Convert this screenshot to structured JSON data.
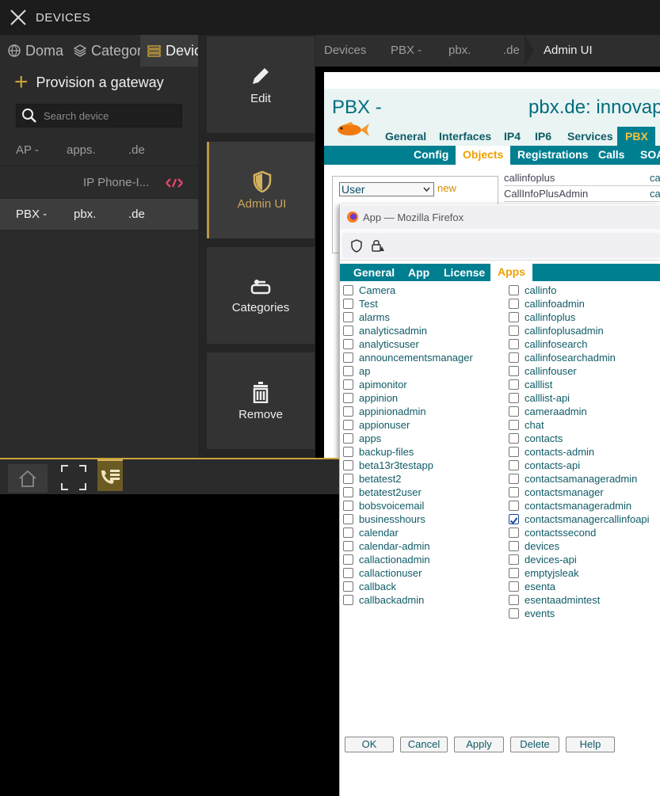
{
  "header": {
    "title": "DEVICES"
  },
  "tabs": [
    {
      "label": "Doma"
    },
    {
      "label": "Categor"
    },
    {
      "label": "Devic"
    }
  ],
  "provision": {
    "label": "Provision a gateway"
  },
  "search": {
    "placeholder": "Search device"
  },
  "devices": [
    {
      "col1": "AP -",
      "col2": "apps.",
      "col3": ".de"
    },
    {
      "col1": "",
      "col2": "IP Phone-I...",
      "col3": ""
    },
    {
      "col1": "PBX -",
      "col2": "pbx.",
      "col3": ".de"
    }
  ],
  "actions": [
    {
      "label": "Edit"
    },
    {
      "label": "Admin UI"
    },
    {
      "label": "Categories"
    },
    {
      "label": "Remove"
    }
  ],
  "breadcrumb": [
    "Devices",
    "PBX -",
    "pbx.",
    ".de",
    "Admin UI"
  ],
  "pbx": {
    "title": "PBX -",
    "domain": "pbx.de: innovap",
    "nav": [
      "General",
      "Interfaces",
      "IP4",
      "IP6",
      "Services",
      "PBX"
    ],
    "subnav": [
      "Config",
      "Objects",
      "Registrations",
      "Calls",
      "SOA"
    ],
    "objtype": "User",
    "new_label": "new",
    "objects": [
      {
        "name": "callinfoplus",
        "short": "ca"
      },
      {
        "name": "CallInfoPlusAdmin",
        "short": "ca"
      }
    ]
  },
  "popup": {
    "window_title": "App — Mozilla Firefox",
    "tabs": [
      "General",
      "App",
      "License",
      "Apps"
    ],
    "apps_left": [
      "Camera",
      "Test",
      "alarms",
      "analyticsadmin",
      "analyticsuser",
      "announcementsmanager",
      "ap",
      "apimonitor",
      "appinion",
      "appinionadmin",
      "appionuser",
      "apps",
      "backup-files",
      "beta13r3testapp",
      "betatest2",
      "betatest2user",
      "bobsvoicemail",
      "businesshours",
      "calendar",
      "calendar-admin",
      "callactionadmin",
      "callactionuser",
      "callback",
      "callbackadmin"
    ],
    "apps_right": [
      "callinfo",
      "callinfoadmin",
      "callinfoplus",
      "callinfoplusadmin",
      "callinfosearch",
      "callinfosearchadmin",
      "callinfouser",
      "calllist",
      "calllist-api",
      "cameraadmin",
      "chat",
      "contacts",
      "contacts-admin",
      "contacts-api",
      "contactsamanageradmin",
      "contactsmanager",
      "contactsmanageradmin",
      "contactsmanagercallinfoapi",
      "contactssecond",
      "devices",
      "devices-api",
      "emptyjsleak",
      "esenta",
      "esentaadmintest",
      "events"
    ],
    "checked_right": [
      "contactsmanagercallinfoapi"
    ],
    "buttons": [
      "OK",
      "Cancel",
      "Apply",
      "Delete",
      "Help"
    ]
  },
  "colors": {
    "accent": "#c9a33a",
    "teal": "#007f91",
    "orange": "#f0a000"
  }
}
